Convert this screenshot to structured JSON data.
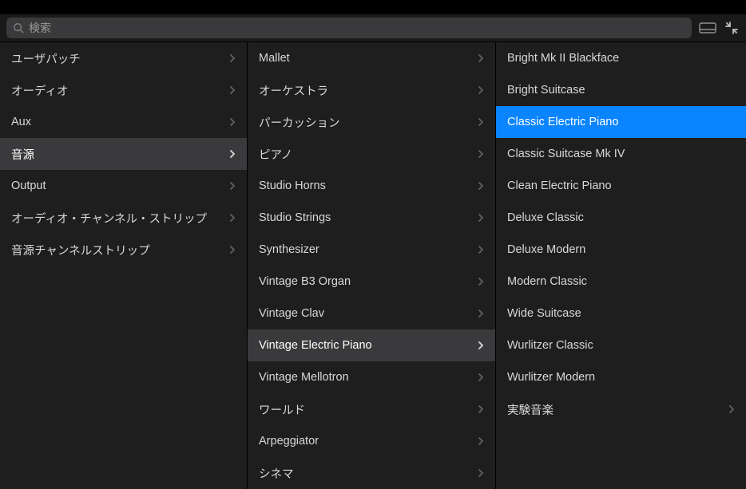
{
  "search": {
    "placeholder": "検索"
  },
  "col1": [
    {
      "label": "ユーザパッチ",
      "submenu": true,
      "active": false
    },
    {
      "label": "オーディオ",
      "submenu": true,
      "active": false
    },
    {
      "label": "Aux",
      "submenu": true,
      "active": false
    },
    {
      "label": "音源",
      "submenu": true,
      "active": true
    },
    {
      "label": "Output",
      "submenu": true,
      "active": false
    },
    {
      "label": "オーディオ・チャンネル・ストリップ",
      "submenu": true,
      "active": false
    },
    {
      "label": "音源チャンネルストリップ",
      "submenu": true,
      "active": false
    }
  ],
  "col2": [
    {
      "label": "Mallet",
      "submenu": true,
      "active": false
    },
    {
      "label": "オーケストラ",
      "submenu": true,
      "active": false
    },
    {
      "label": "パーカッション",
      "submenu": true,
      "active": false
    },
    {
      "label": "ピアノ",
      "submenu": true,
      "active": false
    },
    {
      "label": "Studio Horns",
      "submenu": true,
      "active": false
    },
    {
      "label": "Studio Strings",
      "submenu": true,
      "active": false
    },
    {
      "label": "Synthesizer",
      "submenu": true,
      "active": false
    },
    {
      "label": "Vintage B3 Organ",
      "submenu": true,
      "active": false
    },
    {
      "label": "Vintage Clav",
      "submenu": true,
      "active": false
    },
    {
      "label": "Vintage Electric Piano",
      "submenu": true,
      "active": true
    },
    {
      "label": "Vintage Mellotron",
      "submenu": true,
      "active": false
    },
    {
      "label": "ワールド",
      "submenu": true,
      "active": false
    },
    {
      "label": "Arpeggiator",
      "submenu": true,
      "active": false
    },
    {
      "label": "シネマ",
      "submenu": true,
      "active": false
    }
  ],
  "col3": [
    {
      "label": "Bright Mk II Blackface",
      "submenu": false,
      "selected": false
    },
    {
      "label": "Bright Suitcase",
      "submenu": false,
      "selected": false
    },
    {
      "label": "Classic Electric Piano",
      "submenu": false,
      "selected": true
    },
    {
      "label": "Classic Suitcase Mk IV",
      "submenu": false,
      "selected": false
    },
    {
      "label": "Clean Electric Piano",
      "submenu": false,
      "selected": false
    },
    {
      "label": "Deluxe Classic",
      "submenu": false,
      "selected": false
    },
    {
      "label": "Deluxe Modern",
      "submenu": false,
      "selected": false
    },
    {
      "label": "Modern Classic",
      "submenu": false,
      "selected": false
    },
    {
      "label": "Wide Suitcase",
      "submenu": false,
      "selected": false
    },
    {
      "label": "Wurlitzer Classic",
      "submenu": false,
      "selected": false
    },
    {
      "label": "Wurlitzer Modern",
      "submenu": false,
      "selected": false
    },
    {
      "label": "実験音楽",
      "submenu": true,
      "selected": false
    }
  ]
}
